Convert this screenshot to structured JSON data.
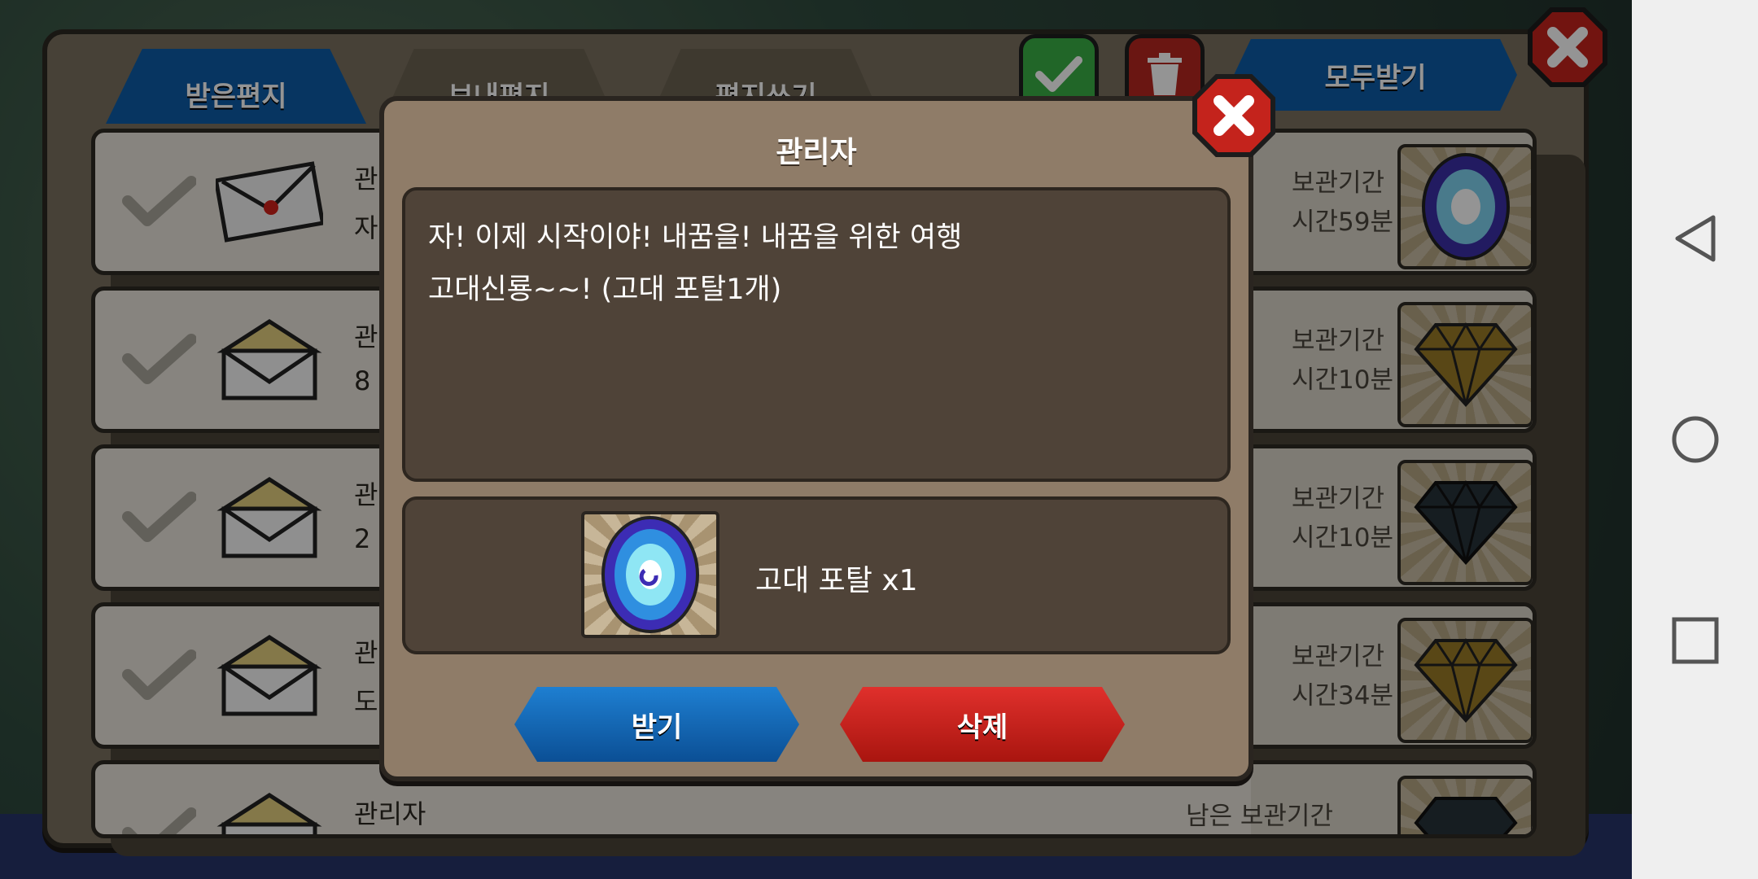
{
  "tabs": {
    "received": "받은편지",
    "sent": "보내편지",
    "write": "편지쓰기"
  },
  "toolbar": {
    "receive_all": "모두받기"
  },
  "mail_rows": [
    {
      "sender": "관",
      "sub": "자",
      "storage_label": "보관기간",
      "storage_time": "시간59분",
      "reward_icon": "portal-icon",
      "envelope": "sealed-envelope-icon"
    },
    {
      "sender": "관",
      "sub": "8",
      "storage_label": "보관기간",
      "storage_time": "시간10분",
      "reward_icon": "gold-gem-icon",
      "envelope": "open-envelope-icon"
    },
    {
      "sender": "관",
      "sub": "2",
      "storage_label": "보관기간",
      "storage_time": "시간10분",
      "reward_icon": "dark-gem-icon",
      "envelope": "open-envelope-icon"
    },
    {
      "sender": "관",
      "sub": "도",
      "storage_label": "보관기간",
      "storage_time": "시간34분",
      "reward_icon": "gold-gem-icon",
      "envelope": "open-envelope-icon"
    },
    {
      "sender": "관리자",
      "sub": "",
      "storage_label": "남은 보관기간",
      "storage_time": "",
      "reward_icon": "dark-gem-icon",
      "envelope": "open-envelope-icon"
    }
  ],
  "dialog": {
    "title": "관리자",
    "message": "자! 이제 시작이야! 내꿈을! 내꿈을 위한 여행\n고대신룡~~! (고대 포탈1개)",
    "item_label": "고대 포탈 x1",
    "item_icon": "ancient-portal-icon",
    "receive_button": "받기",
    "delete_button": "삭제"
  },
  "colors": {
    "accent_blue": "#0d5ca8",
    "delete_red": "#c01e19",
    "confirm_green": "#39b046",
    "dialog_bg": "#8f7c68"
  },
  "nav": {
    "back": "back-icon",
    "home": "home-icon",
    "recents": "recents-icon"
  }
}
